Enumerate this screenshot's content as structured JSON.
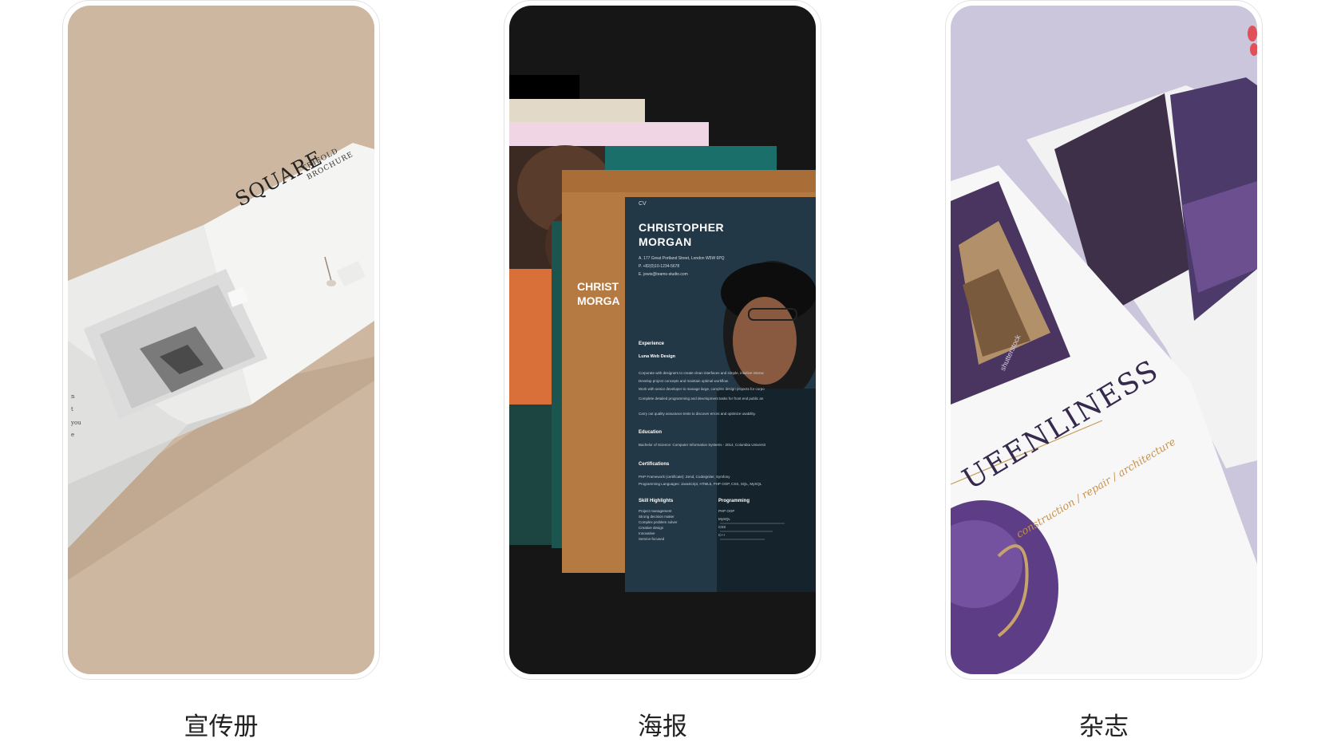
{
  "cards": [
    {
      "caption": "宣传册",
      "brochure": {
        "title": "SQUARE",
        "subtitle_line1": "TRIFOLD",
        "subtitle_line2": "BROCHURE"
      }
    },
    {
      "caption": "海报",
      "resume": {
        "cv_label": "CV",
        "name_line1": "CHRISTOPHER",
        "name_line2": "MORGAN",
        "back_name_line1": "CHRIST",
        "back_name_line2": "MORGA",
        "address": "A.  177 Great Portland Street, London W5W 6PQ",
        "phone": "P.  +82(0)10-1234-5678",
        "email": "E.  jewis@teams-studio.com",
        "experience_heading": "Experience",
        "job_title": "Luna Web Design",
        "job_lines": [
          "Corporate with designers to create clean interfaces and simple, intuitive interac",
          "Develop project concepts and maintain optimal workflow.",
          "Work with senior developer to manage large, complex design projects for corpo",
          "Complete detailed programming and development tasks for front end public an",
          "Carry out quality assurance tests to discover errors and optimize usability."
        ],
        "education_heading": "Education",
        "education_line": "Bachelor of Science: Computer Information Systems - 2014, Columbia Universit",
        "certifications_heading": "Certifications",
        "cert_lines": [
          "PHP Framework (certificate):  Zend, Codeigniter, Symfony",
          "Programming Languages: JavaScript, HTML5, PHP OOP, CSS, SQL, MySQL"
        ],
        "skills_heading": "Skill Highlights",
        "skills": [
          "Project management",
          "Strong decision maker",
          "Complex problem solver",
          "Creative design",
          "Innovative",
          "Service-focused"
        ],
        "programming_heading": "Programming",
        "programming": [
          "PHP OOP",
          "MySQL",
          "CSS",
          "C++"
        ]
      }
    },
    {
      "caption": "杂志",
      "magazine": {
        "headline": "UEENLINESS",
        "tagline": "construction / repair / architecture",
        "watermark": "shutterstock"
      }
    }
  ]
}
